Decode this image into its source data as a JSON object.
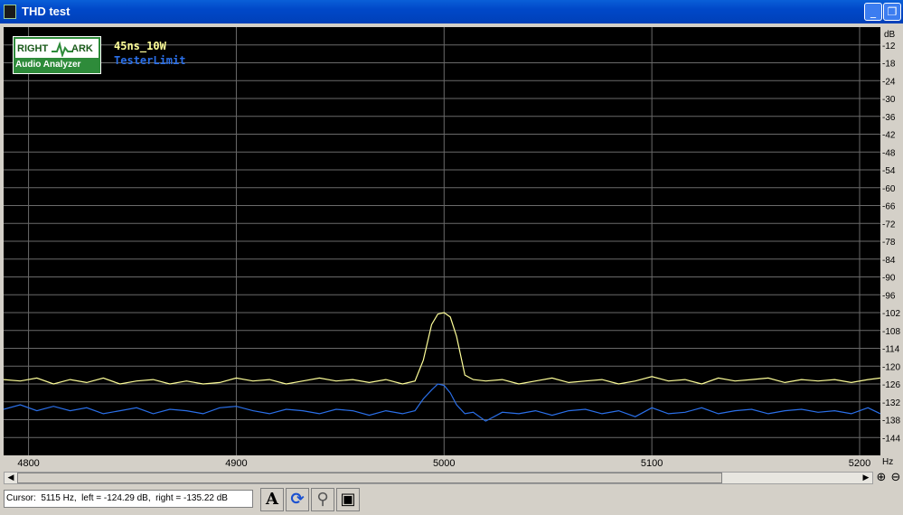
{
  "window": {
    "title": "THD test",
    "minimize_icon": "minimize-icon",
    "restore_icon": "restore-icon"
  },
  "logo": {
    "line1_left": "RIGHT",
    "line1_right": "ARK",
    "line2": "Audio Analyzer"
  },
  "legend": [
    {
      "label": "45ns_10W",
      "color": "#ffff99"
    },
    {
      "label": "TesterLimit",
      "color": "#2a6fe8"
    }
  ],
  "status": {
    "cursor_text": "Cursor:  5115 Hz,  left = -124.29 dB,  right = -135.22 dB"
  },
  "toolbar": {
    "text_button_label": "A",
    "refresh_icon": "refresh-icon",
    "search_icon": "search-icon",
    "save_icon": "save-icon"
  },
  "chart_data": {
    "type": "line",
    "title": "",
    "xlabel": "Hz",
    "ylabel": "dB",
    "xlim": [
      4788,
      5210
    ],
    "ylim": [
      -150,
      -6
    ],
    "x_ticks": [
      4800,
      4900,
      5000,
      5100,
      5200
    ],
    "y_ticks": [
      -12,
      -18,
      -24,
      -30,
      -36,
      -42,
      -48,
      -54,
      -60,
      -66,
      -72,
      -78,
      -84,
      -90,
      -96,
      -102,
      -108,
      -114,
      -120,
      -126,
      -132,
      -138,
      -144
    ],
    "grid": true,
    "background": "#000000",
    "series": [
      {
        "name": "45ns_10W",
        "color": "#ffff99",
        "x": [
          4788,
          4796,
          4804,
          4812,
          4820,
          4828,
          4836,
          4844,
          4852,
          4860,
          4868,
          4876,
          4884,
          4892,
          4900,
          4908,
          4916,
          4924,
          4932,
          4940,
          4948,
          4956,
          4964,
          4972,
          4980,
          4986,
          4990,
          4994,
          4997,
          5000,
          5003,
          5006,
          5010,
          5014,
          5020,
          5028,
          5036,
          5044,
          5052,
          5060,
          5068,
          5076,
          5084,
          5092,
          5100,
          5108,
          5116,
          5124,
          5132,
          5140,
          5148,
          5156,
          5164,
          5172,
          5180,
          5188,
          5196,
          5204,
          5210
        ],
        "y": [
          -124.5,
          -125,
          -124,
          -126,
          -124.5,
          -125.5,
          -124,
          -126,
          -125,
          -124.5,
          -126,
          -125,
          -126,
          -125.5,
          -124,
          -125,
          -124.5,
          -126,
          -125,
          -124,
          -125,
          -124.5,
          -125.5,
          -124.5,
          -126,
          -125,
          -118,
          -106,
          -102.5,
          -102,
          -103.5,
          -110,
          -123,
          -124.5,
          -125,
          -124.5,
          -126,
          -125,
          -124,
          -125.5,
          -125,
          -124.5,
          -126,
          -125,
          -123.5,
          -125,
          -124.5,
          -126,
          -124,
          -125,
          -124.5,
          -124,
          -125.5,
          -124.5,
          -125,
          -124.5,
          -125.5,
          -124.5,
          -124
        ]
      },
      {
        "name": "TesterLimit",
        "color": "#2a6fe8",
        "x": [
          4788,
          4796,
          4804,
          4812,
          4820,
          4828,
          4836,
          4844,
          4852,
          4860,
          4868,
          4876,
          4884,
          4892,
          4900,
          4908,
          4916,
          4924,
          4932,
          4940,
          4948,
          4956,
          4964,
          4972,
          4980,
          4986,
          4990,
          4994,
          4997,
          5000,
          5003,
          5006,
          5010,
          5014,
          5020,
          5028,
          5036,
          5044,
          5052,
          5060,
          5068,
          5076,
          5084,
          5092,
          5100,
          5108,
          5116,
          5124,
          5132,
          5140,
          5148,
          5156,
          5164,
          5172,
          5180,
          5188,
          5196,
          5204,
          5210
        ],
        "y": [
          -134.5,
          -133,
          -135,
          -133.5,
          -135,
          -134,
          -136,
          -135,
          -134,
          -136,
          -134.5,
          -135,
          -136,
          -134,
          -133.5,
          -135,
          -136,
          -134.5,
          -135,
          -136,
          -134.5,
          -135,
          -136.5,
          -135,
          -136,
          -135,
          -131,
          -128,
          -126,
          -126.5,
          -129,
          -133,
          -136,
          -135.5,
          -138.5,
          -135.5,
          -136,
          -135,
          -136.5,
          -135,
          -134.5,
          -136,
          -135,
          -137,
          -134,
          -136,
          -135.5,
          -134,
          -136,
          -135,
          -134.5,
          -136,
          -135,
          -134.5,
          -135.5,
          -135,
          -136,
          -134,
          -136
        ]
      }
    ]
  }
}
